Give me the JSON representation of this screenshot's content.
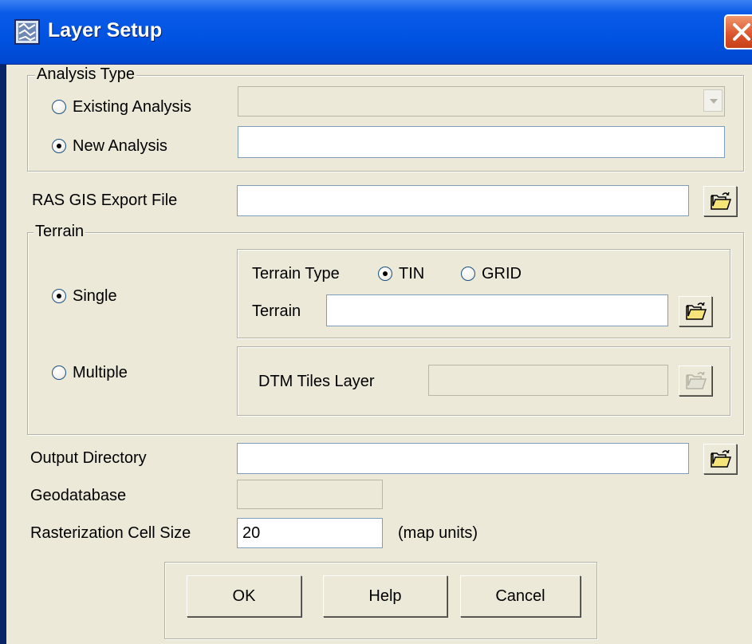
{
  "window": {
    "title": "Layer Setup"
  },
  "analysis_type": {
    "legend": "Analysis Type",
    "existing_label": "Existing Analysis",
    "existing_selected": false,
    "existing_value": "",
    "new_label": "New Analysis",
    "new_selected": true,
    "new_value": ""
  },
  "ras_export": {
    "label": "RAS GIS Export File",
    "value": ""
  },
  "terrain": {
    "legend": "Terrain",
    "single_label": "Single",
    "single_selected": true,
    "multiple_label": "Multiple",
    "multiple_selected": false,
    "terrain_type_label": "Terrain Type",
    "tin_label": "TIN",
    "tin_selected": true,
    "grid_label": "GRID",
    "grid_selected": false,
    "terrain_label": "Terrain",
    "terrain_value": "",
    "dtm_label": "DTM Tiles Layer",
    "dtm_value": ""
  },
  "output": {
    "directory_label": "Output Directory",
    "directory_value": "",
    "geodatabase_label": "Geodatabase",
    "geodatabase_value": "",
    "cell_size_label": "Rasterization Cell Size",
    "cell_size_value": "20",
    "cell_size_units": "(map units)"
  },
  "buttons": {
    "ok": "OK",
    "help": "Help",
    "cancel": "Cancel"
  },
  "icons": {
    "app": "layer-setup-icon",
    "close": "close-icon",
    "folder": "open-folder-icon",
    "dropdown": "chevron-down-icon"
  }
}
